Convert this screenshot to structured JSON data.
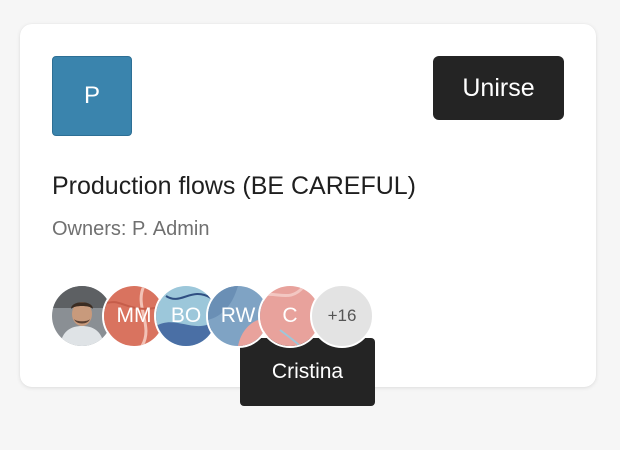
{
  "group": {
    "logo_letter": "P",
    "title": "Production flows (BE CAREFUL)",
    "owners": "Owners: P. Admin",
    "join_label": "Unirse"
  },
  "members": {
    "avatars": [
      {
        "type": "photo",
        "initials": ""
      },
      {
        "type": "pattern",
        "initials": "MM"
      },
      {
        "type": "pattern",
        "initials": "BO"
      },
      {
        "type": "pattern",
        "initials": "RW"
      },
      {
        "type": "pattern",
        "initials": "C"
      }
    ],
    "more_count": "+16",
    "tooltip": "Cristina"
  },
  "colors": {
    "logo": "#3a84ad",
    "button": "#242424",
    "tooltip": "#242424",
    "avatar_coral": "#d9735f",
    "avatar_blue": "#4a6fa5",
    "avatar_light_blue": "#9cc7da",
    "avatar_pink": "#e8a29c"
  }
}
